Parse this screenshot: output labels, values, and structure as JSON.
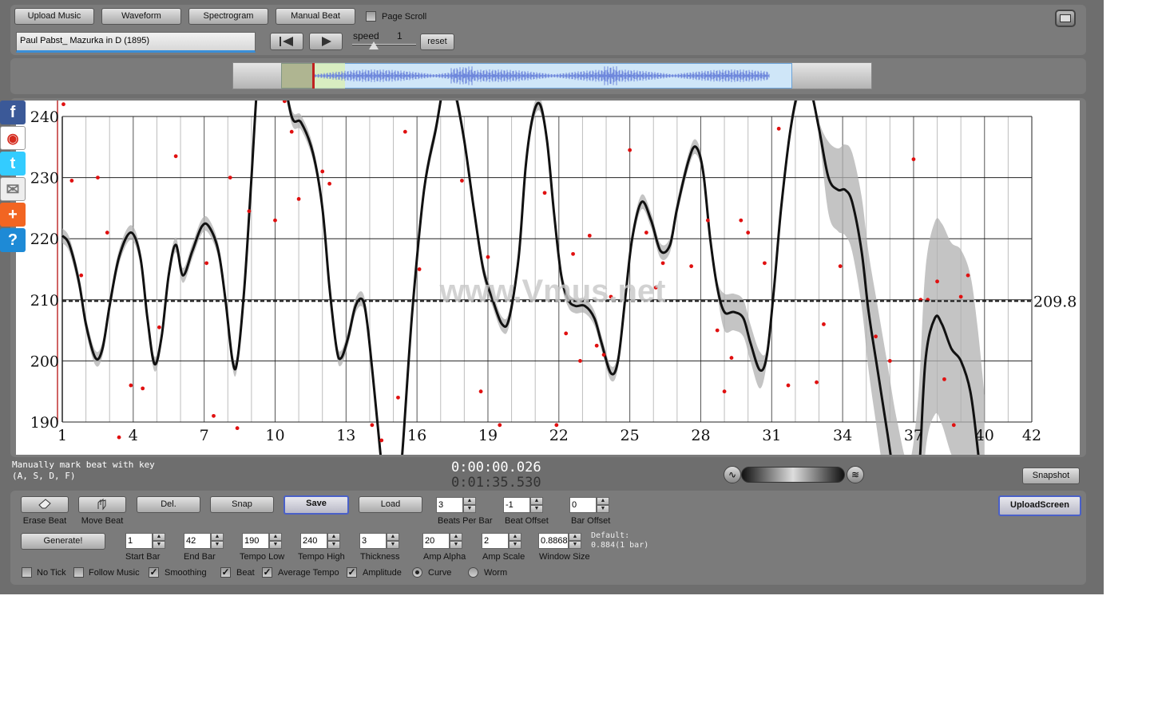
{
  "toolbar": {
    "upload_music": "Upload Music",
    "waveform": "Waveform",
    "spectrogram": "Spectrogram",
    "manual_beat": "Manual Beat",
    "page_scroll": "Page Scroll",
    "track_title": "Paul Pabst_ Mazurka in D (1895)",
    "speed_label": "speed",
    "speed_value": "1",
    "reset": "reset"
  },
  "chart_data": {
    "type": "line",
    "xlabel": "",
    "ylabel": "",
    "xlim": [
      1,
      42
    ],
    "ylim": [
      190,
      240
    ],
    "x_ticks": [
      1,
      4,
      7,
      10,
      13,
      16,
      19,
      22,
      25,
      28,
      31,
      34,
      37,
      40,
      42
    ],
    "y_ticks": [
      190,
      200,
      210,
      220,
      230,
      240
    ],
    "average_tempo": 209.8,
    "average_label": "209.8",
    "watermark": "www.Vmus.net",
    "curve": [
      {
        "x": 1.0,
        "y": 220.5
      },
      {
        "x": 1.3,
        "y": 219
      },
      {
        "x": 1.7,
        "y": 213
      },
      {
        "x": 2.0,
        "y": 206
      },
      {
        "x": 2.4,
        "y": 200.5
      },
      {
        "x": 2.7,
        "y": 202
      },
      {
        "x": 3.0,
        "y": 209
      },
      {
        "x": 3.4,
        "y": 217
      },
      {
        "x": 3.9,
        "y": 221
      },
      {
        "x": 4.3,
        "y": 217
      },
      {
        "x": 4.6,
        "y": 207
      },
      {
        "x": 4.9,
        "y": 199.5
      },
      {
        "x": 5.2,
        "y": 204
      },
      {
        "x": 5.5,
        "y": 214
      },
      {
        "x": 5.8,
        "y": 219
      },
      {
        "x": 6.1,
        "y": 214
      },
      {
        "x": 6.5,
        "y": 218
      },
      {
        "x": 6.9,
        "y": 222
      },
      {
        "x": 7.2,
        "y": 222
      },
      {
        "x": 7.6,
        "y": 218
      },
      {
        "x": 7.9,
        "y": 210
      },
      {
        "x": 8.2,
        "y": 200
      },
      {
        "x": 8.4,
        "y": 200
      },
      {
        "x": 8.7,
        "y": 212
      },
      {
        "x": 9.0,
        "y": 230
      },
      {
        "x": 9.3,
        "y": 248
      },
      {
        "x": 9.7,
        "y": 258
      },
      {
        "x": 10.2,
        "y": 250
      },
      {
        "x": 10.7,
        "y": 240
      },
      {
        "x": 11.1,
        "y": 239
      },
      {
        "x": 11.6,
        "y": 234
      },
      {
        "x": 12.0,
        "y": 225
      },
      {
        "x": 12.3,
        "y": 212
      },
      {
        "x": 12.6,
        "y": 202
      },
      {
        "x": 12.8,
        "y": 200.5
      },
      {
        "x": 13.1,
        "y": 204
      },
      {
        "x": 13.4,
        "y": 209
      },
      {
        "x": 13.7,
        "y": 210
      },
      {
        "x": 13.9,
        "y": 206
      },
      {
        "x": 14.2,
        "y": 195
      },
      {
        "x": 14.5,
        "y": 183
      },
      {
        "x": 14.8,
        "y": 172
      },
      {
        "x": 15.1,
        "y": 172
      },
      {
        "x": 15.4,
        "y": 186
      },
      {
        "x": 15.8,
        "y": 208
      },
      {
        "x": 16.3,
        "y": 228
      },
      {
        "x": 16.8,
        "y": 238
      },
      {
        "x": 17.2,
        "y": 246
      },
      {
        "x": 17.6,
        "y": 244
      },
      {
        "x": 18.0,
        "y": 236
      },
      {
        "x": 18.4,
        "y": 225
      },
      {
        "x": 18.8,
        "y": 215
      },
      {
        "x": 19.2,
        "y": 210
      },
      {
        "x": 19.6,
        "y": 206
      },
      {
        "x": 19.9,
        "y": 207
      },
      {
        "x": 20.3,
        "y": 217
      },
      {
        "x": 20.6,
        "y": 232
      },
      {
        "x": 20.9,
        "y": 240
      },
      {
        "x": 21.2,
        "y": 242
      },
      {
        "x": 21.5,
        "y": 236
      },
      {
        "x": 21.8,
        "y": 224
      },
      {
        "x": 22.1,
        "y": 214
      },
      {
        "x": 22.4,
        "y": 210
      },
      {
        "x": 22.7,
        "y": 209
      },
      {
        "x": 23.1,
        "y": 209
      },
      {
        "x": 23.5,
        "y": 207
      },
      {
        "x": 23.8,
        "y": 203
      },
      {
        "x": 24.2,
        "y": 198
      },
      {
        "x": 24.5,
        "y": 200
      },
      {
        "x": 24.8,
        "y": 210
      },
      {
        "x": 25.1,
        "y": 220
      },
      {
        "x": 25.5,
        "y": 226
      },
      {
        "x": 25.9,
        "y": 223
      },
      {
        "x": 26.3,
        "y": 218
      },
      {
        "x": 26.7,
        "y": 219
      },
      {
        "x": 27.0,
        "y": 225
      },
      {
        "x": 27.5,
        "y": 233
      },
      {
        "x": 27.8,
        "y": 235
      },
      {
        "x": 28.1,
        "y": 231
      },
      {
        "x": 28.4,
        "y": 220
      },
      {
        "x": 28.7,
        "y": 212
      },
      {
        "x": 29.0,
        "y": 208
      },
      {
        "x": 29.4,
        "y": 208
      },
      {
        "x": 29.8,
        "y": 207
      },
      {
        "x": 30.1,
        "y": 203
      },
      {
        "x": 30.5,
        "y": 198.5
      },
      {
        "x": 30.8,
        "y": 201
      },
      {
        "x": 31.1,
        "y": 212
      },
      {
        "x": 31.4,
        "y": 225
      },
      {
        "x": 31.8,
        "y": 238
      },
      {
        "x": 32.2,
        "y": 245
      },
      {
        "x": 32.6,
        "y": 245
      },
      {
        "x": 33.0,
        "y": 238
      },
      {
        "x": 33.4,
        "y": 230
      },
      {
        "x": 33.8,
        "y": 228
      },
      {
        "x": 34.1,
        "y": 228
      },
      {
        "x": 34.4,
        "y": 226
      },
      {
        "x": 34.8,
        "y": 218
      },
      {
        "x": 35.1,
        "y": 208
      },
      {
        "x": 35.5,
        "y": 198
      },
      {
        "x": 35.9,
        "y": 188
      },
      {
        "x": 36.3,
        "y": 178
      },
      {
        "x": 36.8,
        "y": 170
      },
      {
        "x": 37.2,
        "y": 180
      },
      {
        "x": 37.5,
        "y": 200
      },
      {
        "x": 37.9,
        "y": 207
      },
      {
        "x": 38.2,
        "y": 206
      },
      {
        "x": 38.6,
        "y": 202
      },
      {
        "x": 39.0,
        "y": 200
      },
      {
        "x": 39.4,
        "y": 195
      },
      {
        "x": 39.7,
        "y": 186
      },
      {
        "x": 40.0,
        "y": 174
      }
    ],
    "beats": [
      {
        "x": 1.05,
        "y": 242
      },
      {
        "x": 1.4,
        "y": 229.5
      },
      {
        "x": 1.8,
        "y": 214
      },
      {
        "x": 2.5,
        "y": 230
      },
      {
        "x": 2.9,
        "y": 221
      },
      {
        "x": 3.4,
        "y": 187.5
      },
      {
        "x": 3.9,
        "y": 196
      },
      {
        "x": 4.4,
        "y": 195.5
      },
      {
        "x": 5.1,
        "y": 205.5
      },
      {
        "x": 5.8,
        "y": 233.5
      },
      {
        "x": 7.1,
        "y": 216
      },
      {
        "x": 7.4,
        "y": 191
      },
      {
        "x": 8.1,
        "y": 230
      },
      {
        "x": 8.4,
        "y": 189
      },
      {
        "x": 8.9,
        "y": 224.5
      },
      {
        "x": 10.0,
        "y": 223
      },
      {
        "x": 10.4,
        "y": 242.5
      },
      {
        "x": 10.7,
        "y": 237.5
      },
      {
        "x": 11.0,
        "y": 226.5
      },
      {
        "x": 12.0,
        "y": 231
      },
      {
        "x": 12.3,
        "y": 229
      },
      {
        "x": 14.1,
        "y": 189.5
      },
      {
        "x": 14.5,
        "y": 187
      },
      {
        "x": 15.2,
        "y": 194
      },
      {
        "x": 15.5,
        "y": 237.5
      },
      {
        "x": 16.1,
        "y": 215
      },
      {
        "x": 17.9,
        "y": 229.5
      },
      {
        "x": 18.7,
        "y": 195
      },
      {
        "x": 19.0,
        "y": 217
      },
      {
        "x": 19.5,
        "y": 189.5
      },
      {
        "x": 21.4,
        "y": 227.5
      },
      {
        "x": 21.9,
        "y": 189.5
      },
      {
        "x": 22.3,
        "y": 204.5
      },
      {
        "x": 22.6,
        "y": 217.5
      },
      {
        "x": 22.9,
        "y": 200
      },
      {
        "x": 23.3,
        "y": 220.5
      },
      {
        "x": 23.6,
        "y": 202.5
      },
      {
        "x": 23.9,
        "y": 201
      },
      {
        "x": 24.2,
        "y": 210.5
      },
      {
        "x": 25.0,
        "y": 234.5
      },
      {
        "x": 25.7,
        "y": 221
      },
      {
        "x": 26.1,
        "y": 212
      },
      {
        "x": 26.4,
        "y": 216
      },
      {
        "x": 27.6,
        "y": 215.5
      },
      {
        "x": 28.3,
        "y": 223
      },
      {
        "x": 28.7,
        "y": 205
      },
      {
        "x": 29.0,
        "y": 195
      },
      {
        "x": 29.3,
        "y": 200.5
      },
      {
        "x": 29.7,
        "y": 223
      },
      {
        "x": 30.0,
        "y": 221
      },
      {
        "x": 30.7,
        "y": 216
      },
      {
        "x": 31.3,
        "y": 238
      },
      {
        "x": 31.7,
        "y": 196
      },
      {
        "x": 32.9,
        "y": 196.5
      },
      {
        "x": 33.2,
        "y": 206
      },
      {
        "x": 33.9,
        "y": 215.5
      },
      {
        "x": 35.4,
        "y": 204
      },
      {
        "x": 36.0,
        "y": 200
      },
      {
        "x": 37.0,
        "y": 233
      },
      {
        "x": 37.3,
        "y": 210
      },
      {
        "x": 37.6,
        "y": 210
      },
      {
        "x": 38.0,
        "y": 213
      },
      {
        "x": 38.3,
        "y": 197
      },
      {
        "x": 38.7,
        "y": 189.5
      },
      {
        "x": 39.0,
        "y": 210.5
      },
      {
        "x": 39.3,
        "y": 214
      }
    ]
  },
  "status": {
    "hint_line1": "Manually mark beat with key",
    "hint_line2": "(A, S, D, F)",
    "time_current": "0:00:00.026",
    "time_total": "0:01:35.530",
    "snapshot": "Snapshot"
  },
  "tools": {
    "erase_beat": "Erase Beat",
    "move_beat": "Move Beat",
    "del": "Del.",
    "snap": "Snap",
    "save": "Save",
    "load": "Load",
    "upload_screen": "UploadScreen",
    "generate": "Generate!",
    "default_line1": "Default:",
    "default_line2": "0.884(1 bar)"
  },
  "fields": {
    "beats_per_bar": {
      "label": "Beats Per Bar",
      "value": "3"
    },
    "beat_offset": {
      "label": "Beat Offset",
      "value": "-1"
    },
    "bar_offset": {
      "label": "Bar Offset",
      "value": "0"
    },
    "start_bar": {
      "label": "Start Bar",
      "value": "1"
    },
    "end_bar": {
      "label": "End Bar",
      "value": "42"
    },
    "tempo_low": {
      "label": "Tempo Low",
      "value": "190"
    },
    "tempo_high": {
      "label": "Tempo High",
      "value": "240"
    },
    "thickness": {
      "label": "Thickness",
      "value": "3"
    },
    "amp_alpha": {
      "label": "Amp Alpha",
      "value": "20"
    },
    "amp_scale": {
      "label": "Amp Scale",
      "value": "2"
    },
    "window_size": {
      "label": "Window Size",
      "value": "0.88680"
    }
  },
  "options": {
    "no_tick": "No Tick",
    "follow_music": "Follow Music",
    "smoothing": "Smoothing",
    "beat": "Beat",
    "average_tempo": "Average Tempo",
    "amplitude": "Amplitude",
    "curve": "Curve",
    "worm": "Worm",
    "check_mark": "✓"
  },
  "colors": {
    "beat_dot": "#e01010",
    "curve": "#111111",
    "band": "#b0b0b0",
    "waveform": "#6f88dc",
    "overview_bg": "#cfe6f8"
  }
}
